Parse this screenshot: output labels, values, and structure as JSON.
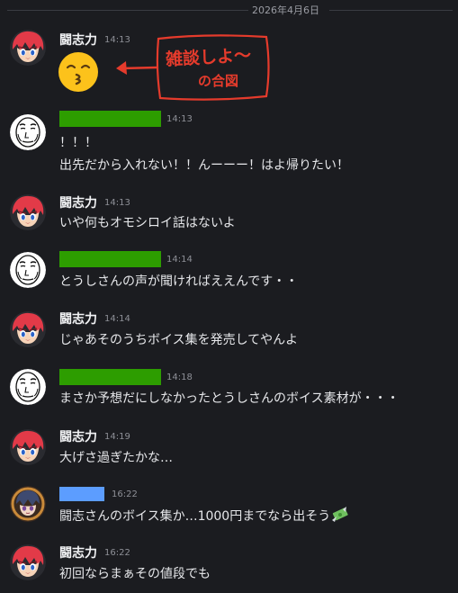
{
  "date_divider": "2026年4月6日",
  "messages": [
    {
      "user": "闘志力",
      "time": "14:13",
      "lines": []
    },
    {
      "user": "",
      "time": "14:13",
      "lines": [
        "！！！",
        "出先だから入れない！！んーーー！はよ帰りたい！"
      ]
    },
    {
      "user": "闘志力",
      "time": "14:13",
      "lines": [
        "いや何もオモシロイ話はないよ"
      ]
    },
    {
      "user": "",
      "time": "14:14",
      "lines": [
        "とうしさんの声が聞ければええんです・・"
      ]
    },
    {
      "user": "闘志力",
      "time": "14:14",
      "lines": [
        "じゃあそのうちボイス集を発売してやんよ"
      ]
    },
    {
      "user": "",
      "time": "14:18",
      "lines": [
        "まさか予想だにしなかったとうしさんのボイス素材が・・・"
      ]
    },
    {
      "user": "闘志力",
      "time": "14:19",
      "lines": [
        "大げさ過ぎたかな…"
      ]
    },
    {
      "user": "",
      "time": "16:22",
      "lines": [
        "闘志さんのボイス集か…1000円までなら出そう"
      ]
    },
    {
      "user": "闘志力",
      "time": "16:22",
      "lines": [
        "初回ならまぁその値段でも"
      ]
    }
  ],
  "annotation": {
    "line1": "雑談しよ〜",
    "line2": "の合図",
    "color": "#e53b2c"
  },
  "colors": {
    "background": "#1b1c20",
    "redact_green": "#2d9d00",
    "redact_blue": "#5c9dff"
  },
  "icons": [
    "kissing-emoji-icon",
    "money-with-wings-icon",
    "arrow-left-icon"
  ]
}
